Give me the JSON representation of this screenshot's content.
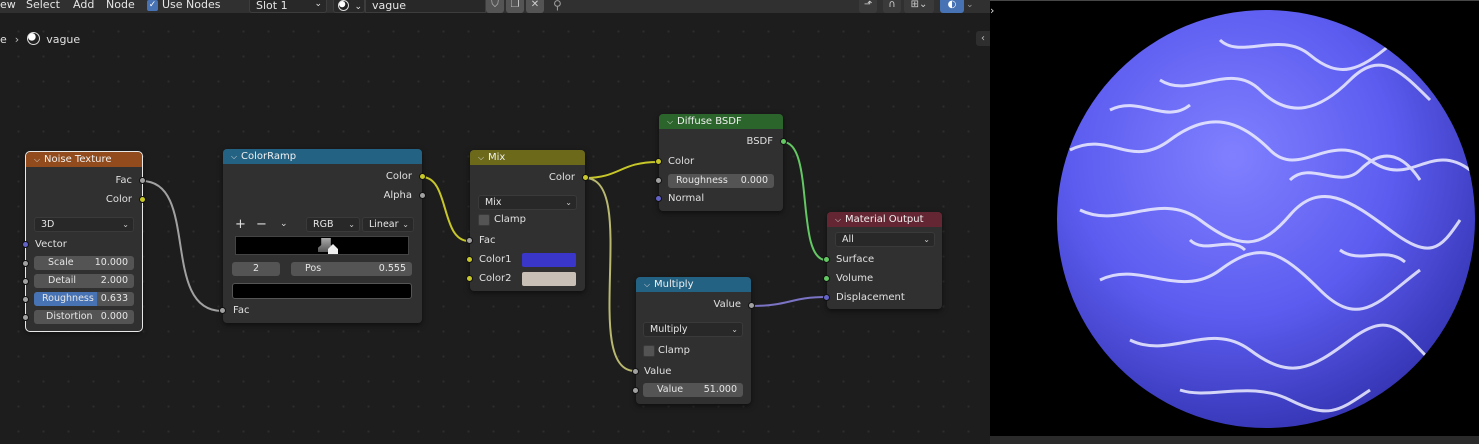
{
  "header": {
    "menu": [
      "ew",
      "Select",
      "Add",
      "Node"
    ],
    "use_nodes_label": "Use Nodes",
    "use_nodes_checked": true,
    "slot": "Slot 1",
    "material_name": "vague"
  },
  "breadcrumb": {
    "parent": "e",
    "material": "vague"
  },
  "nodes": {
    "noise_texture": {
      "title": "Noise Texture",
      "out_fac": "Fac",
      "out_color": "Color",
      "dimensions": "3D",
      "in_vector": "Vector",
      "scale_label": "Scale",
      "scale_value": "10.000",
      "detail_label": "Detail",
      "detail_value": "2.000",
      "roughness_label": "Roughness",
      "roughness_value": "0.633",
      "distortion_label": "Distortion",
      "distortion_value": "0.000"
    },
    "color_ramp": {
      "title": "ColorRamp",
      "out_color": "Color",
      "out_alpha": "Alpha",
      "plus": "+",
      "minus": "−",
      "color_mode": "RGB",
      "interpolation": "Linear",
      "stop_index": "2",
      "pos_label": "Pos",
      "pos_value": "0.555",
      "in_fac": "Fac"
    },
    "mix": {
      "title": "Mix",
      "out_color": "Color",
      "blend_type": "Mix",
      "clamp_label": "Clamp",
      "in_fac": "Fac",
      "in_color1": "Color1",
      "in_color2": "Color2",
      "color1_hex": "#3a36c9",
      "color2_hex": "#c8bfb7"
    },
    "diffuse_bsdf": {
      "title": "Diffuse BSDF",
      "out_bsdf": "BSDF",
      "in_color": "Color",
      "roughness_label": "Roughness",
      "roughness_value": "0.000",
      "in_normal": "Normal"
    },
    "multiply": {
      "title": "Multiply",
      "out_value": "Value",
      "operation": "Multiply",
      "clamp_label": "Clamp",
      "in_value": "Value",
      "value_label": "Value",
      "value_value": "51.000"
    },
    "material_output": {
      "title": "Material Output",
      "target": "All",
      "in_surface": "Surface",
      "in_volume": "Volume",
      "in_displacement": "Displacement"
    }
  },
  "colors": {
    "texture_header": "#914b1c",
    "converter_header": "#246283",
    "color_header": "#6c6a1a",
    "shader_header": "#2b652b",
    "output_header": "#642633",
    "sphere_color": "#5c5cf0"
  }
}
